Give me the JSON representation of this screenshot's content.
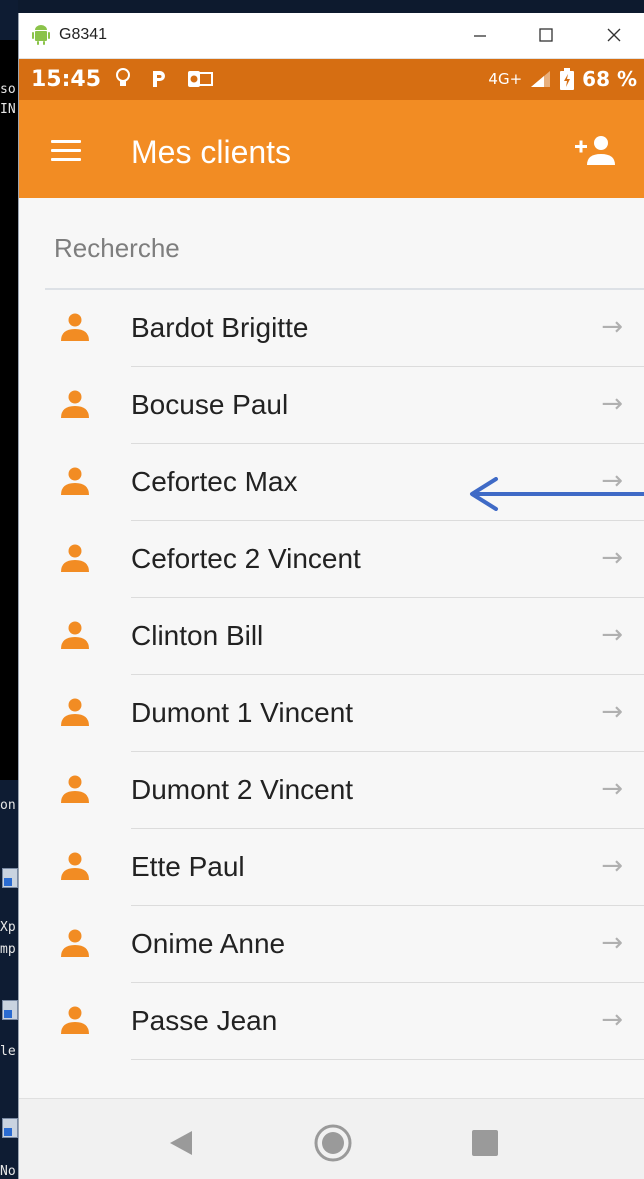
{
  "window": {
    "title": "G8341",
    "minimize_icon": "minimize-icon",
    "maximize_icon": "maximize-icon",
    "close_icon": "close-icon"
  },
  "desktop": {
    "fragments": [
      "so",
      "IN",
      "on",
      "Xp",
      "mp",
      "le",
      "No"
    ]
  },
  "statusbar": {
    "time": "15:45",
    "network": "4G+",
    "battery": "68 %"
  },
  "appbar": {
    "title": "Mes clients",
    "menu_icon": "menu-icon",
    "add_icon": "add-user-icon"
  },
  "search": {
    "placeholder": "Recherche",
    "value": ""
  },
  "clients": [
    {
      "name": "Bardot Brigitte"
    },
    {
      "name": "Bocuse Paul"
    },
    {
      "name": "Cefortec Max"
    },
    {
      "name": "Cefortec 2 Vincent"
    },
    {
      "name": "Clinton Bill"
    },
    {
      "name": "Dumont 1 Vincent"
    },
    {
      "name": "Dumont 2 Vincent"
    },
    {
      "name": "Ette Paul"
    },
    {
      "name": "Onime Anne"
    },
    {
      "name": "Passe Jean"
    }
  ],
  "colors": {
    "accent": "#f28c23",
    "statusbar": "#d66e12",
    "pointer": "#3f6ac6"
  }
}
